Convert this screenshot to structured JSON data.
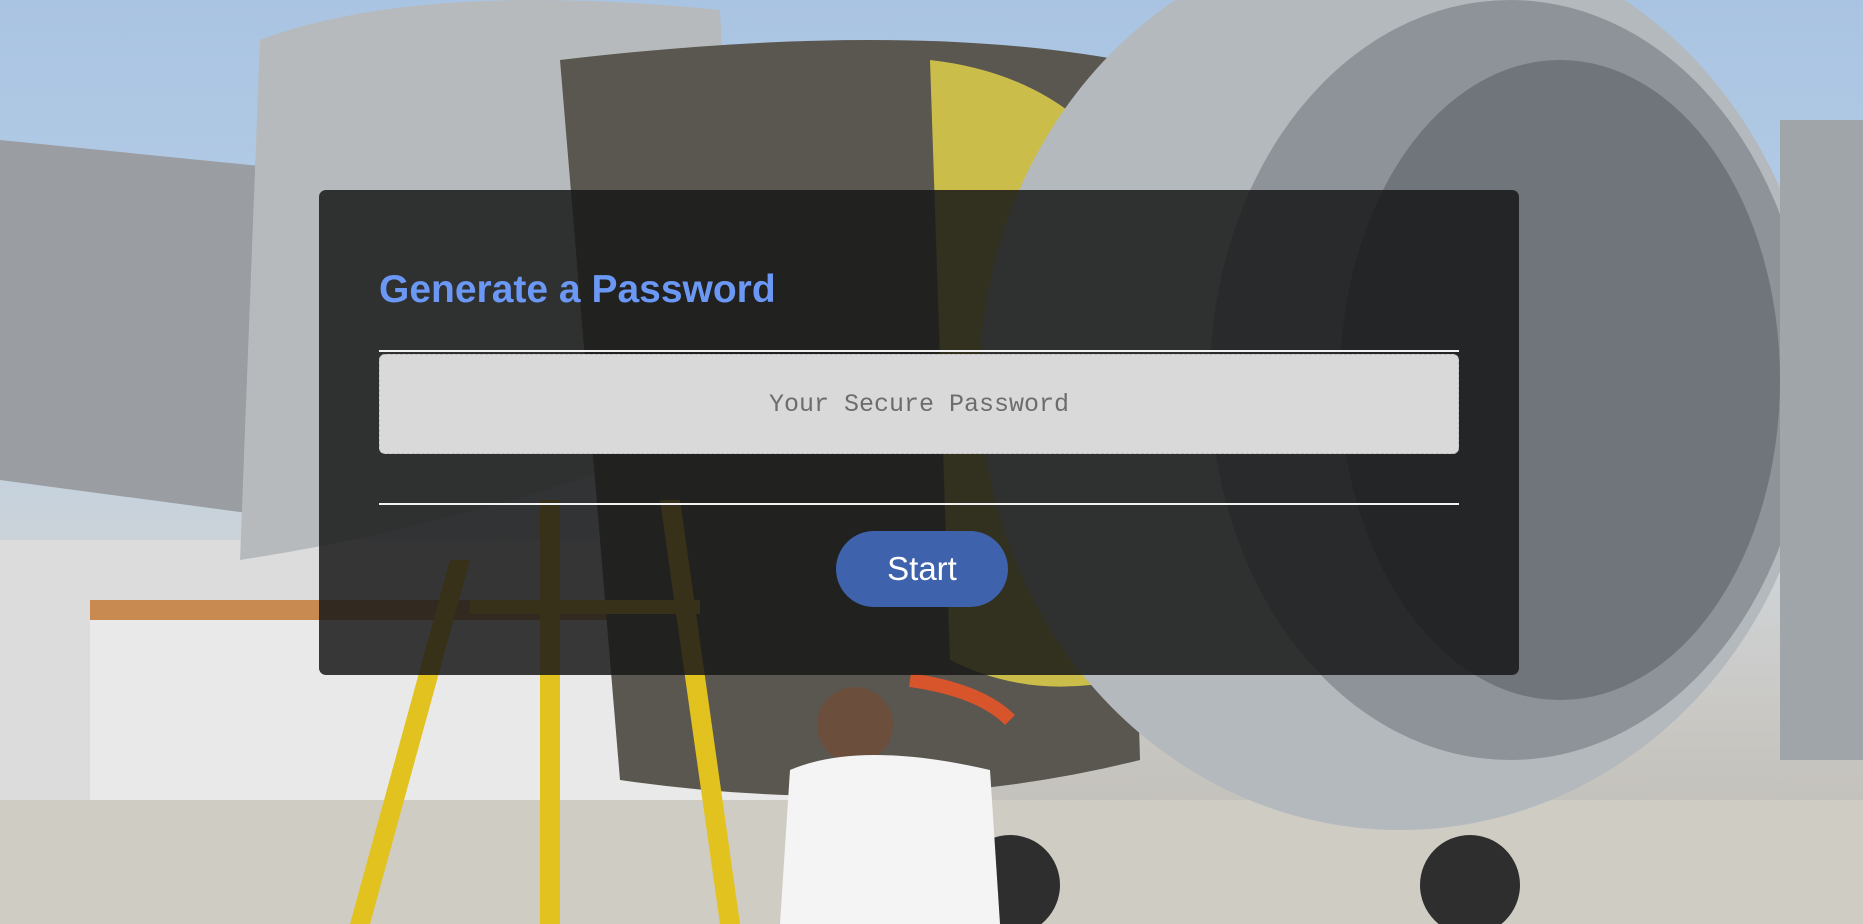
{
  "page": {
    "title": "Generate a Password",
    "password_placeholder": "Your Secure Password",
    "start_label": "Start"
  },
  "background": {
    "description_icon": "aircraft-engine-maintenance-photo"
  },
  "colors": {
    "title": "#6c98f5",
    "button": "#3f62ad",
    "card": "#181818",
    "field": "#d9d9d9"
  }
}
